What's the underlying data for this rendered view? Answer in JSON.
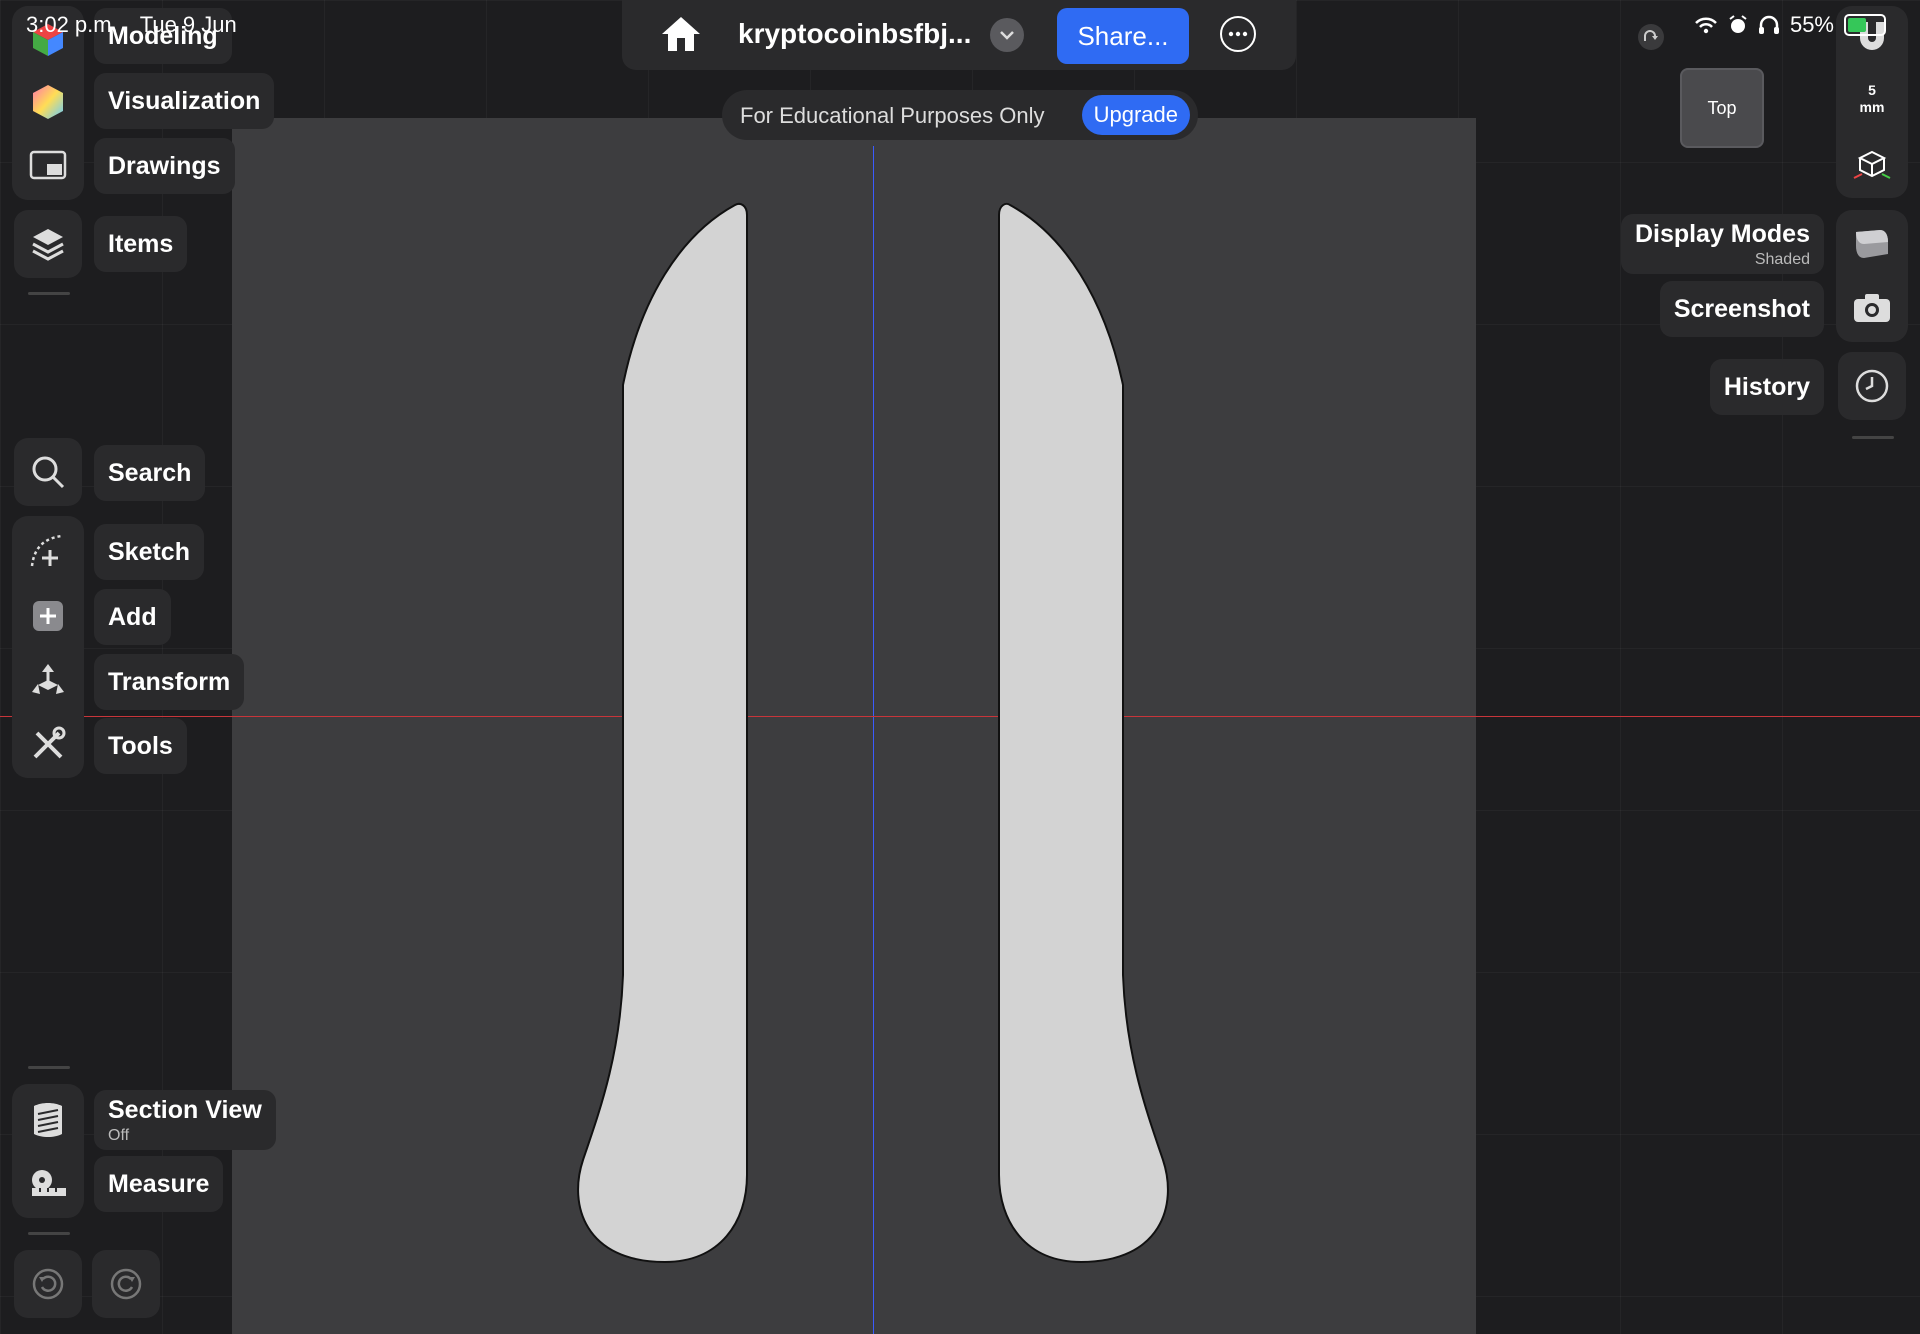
{
  "status_bar": {
    "time": "3:02 p.m.",
    "date": "Tue 9 Jun",
    "battery": "55%"
  },
  "left_toolbar": {
    "workspaces": [
      {
        "label": "Modeling",
        "icon": "modeling-cube-icon"
      },
      {
        "label": "Visualization",
        "icon": "visualization-hexagon-icon"
      },
      {
        "label": "Drawings",
        "icon": "drawings-icon"
      },
      {
        "label": "Items",
        "icon": "layers-icon"
      }
    ],
    "tools": [
      {
        "label": "Search",
        "icon": "search-icon"
      },
      {
        "label": "Sketch",
        "icon": "sketch-icon"
      },
      {
        "label": "Add",
        "icon": "add-icon"
      },
      {
        "label": "Transform",
        "icon": "transform-icon"
      },
      {
        "label": "Tools",
        "icon": "tools-icon"
      }
    ],
    "section_view": {
      "label": "Section View",
      "state": "Off"
    },
    "measure": {
      "label": "Measure"
    }
  },
  "top_bar": {
    "document_name": "kryptocoinbsfbj...",
    "share_label": "Share...",
    "banner_text": "For Educational Purposes Only",
    "upgrade_label": "Upgrade"
  },
  "right_panel": {
    "view_cube_face": "Top",
    "scale_value": "5",
    "scale_unit": "mm",
    "display_modes": {
      "label": "Display Modes",
      "value": "Shaded"
    },
    "screenshot_label": "Screenshot",
    "history_label": "History"
  },
  "colors": {
    "accent": "#2f6bf3",
    "x_axis": "#c8353a",
    "y_axis": "#3a5bff",
    "sketch_fill": "#d3d3d3",
    "plane": "#3d3d3f"
  }
}
